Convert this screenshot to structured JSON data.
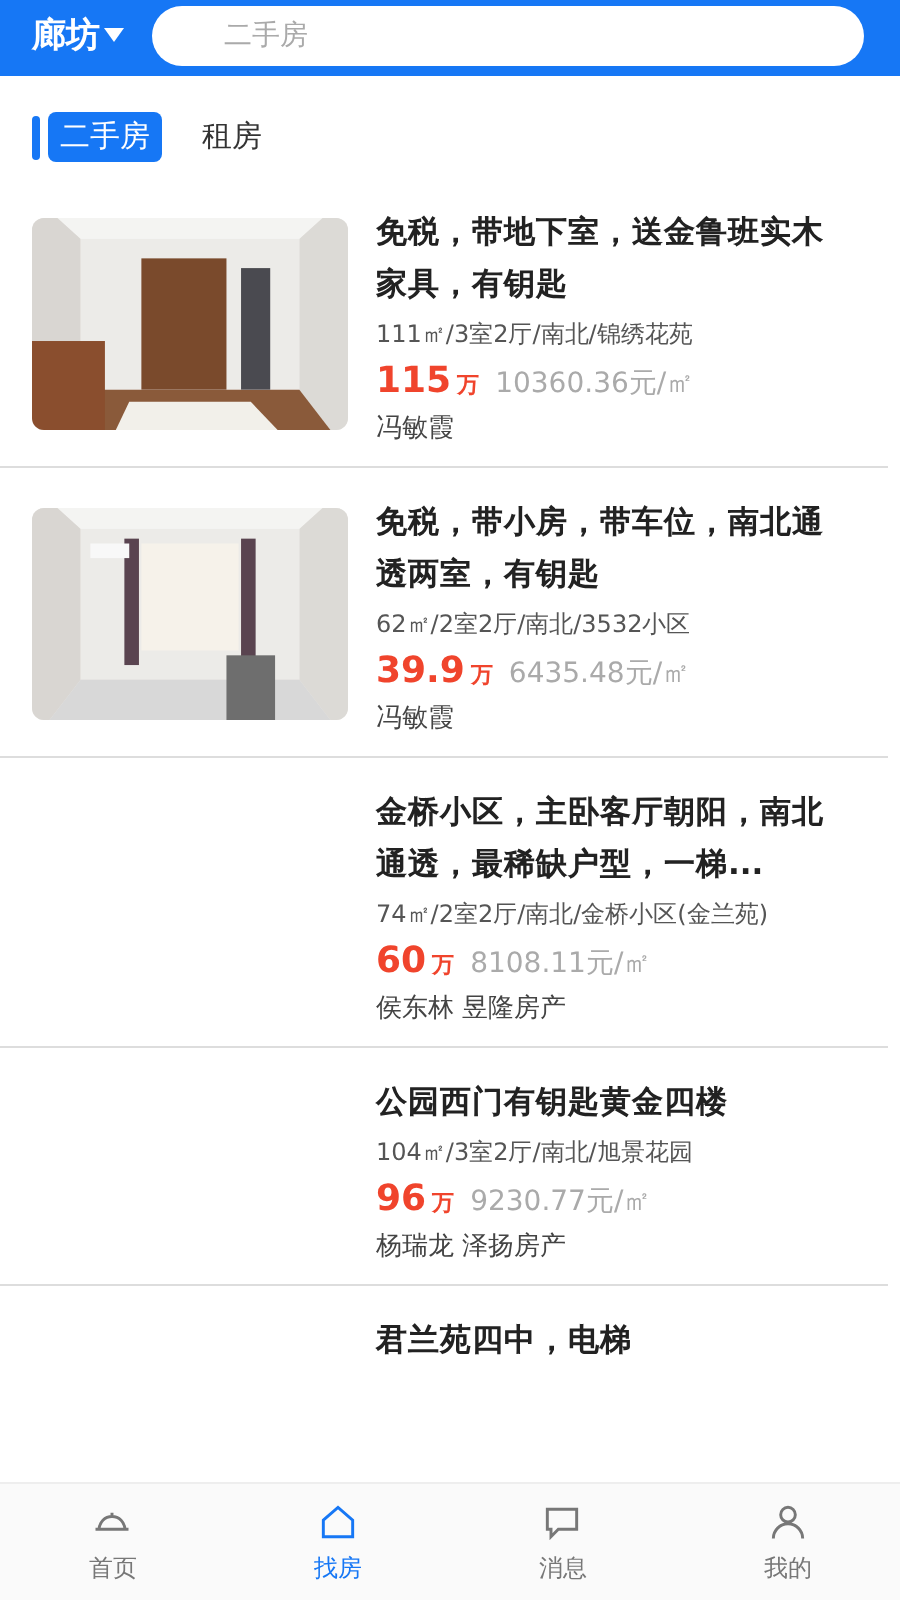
{
  "header": {
    "city": "廊坊",
    "search": {
      "placeholder": "二手房"
    }
  },
  "tabs": [
    {
      "label": "二手房",
      "selected": true
    },
    {
      "label": "租房",
      "selected": false
    }
  ],
  "listings": [
    {
      "title": "免税，带地下室，送金鲁班实木家具，有钥匙",
      "details": "111㎡/3室2厅/南北/锦绣花苑",
      "price": "115",
      "unit": "万",
      "unit_price": "10360.36元/㎡",
      "agent": "冯敏霞"
    },
    {
      "title": "免税，带小房，带车位，南北通透两室，有钥匙",
      "details": "62㎡/2室2厅/南北/3532小区",
      "price": "39.9",
      "unit": "万",
      "unit_price": "6435.48元/㎡",
      "agent": "冯敏霞"
    },
    {
      "kind": "blank",
      "title": "金桥小区，主卧客厅朝阳，南北通透，最稀缺户型，一梯...",
      "details": "74㎡/2室2厅/南北/金桥小区(金兰苑)",
      "price": "60",
      "unit": "万",
      "unit_price": "8108.11元/㎡",
      "agent": "侯东林 昱隆房产"
    },
    {
      "kind": "blank",
      "title": "公园西门有钥匙黄金四楼",
      "details": "104㎡/3室2厅/南北/旭景花园",
      "price": "96",
      "unit": "万",
      "unit_price": "9230.77元/㎡",
      "agent": "杨瑞龙 泽扬房产"
    },
    {
      "kind": "partial",
      "title": "君兰苑四中，电梯"
    }
  ],
  "nav": [
    {
      "label": "首页",
      "selected": false
    },
    {
      "label": "找房",
      "selected": true
    },
    {
      "label": "消息",
      "selected": false
    },
    {
      "label": "我的",
      "selected": false
    }
  ]
}
